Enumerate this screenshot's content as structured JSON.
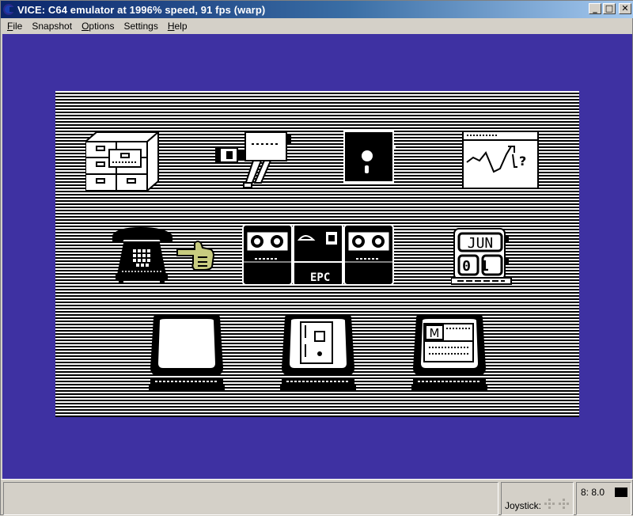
{
  "window": {
    "title": "VICE: C64 emulator at 1996% speed, 91 fps (warp)",
    "controls": {
      "minimize": "_",
      "maximize": "□",
      "close": "✕"
    }
  },
  "menu": {
    "items": [
      {
        "label": "File",
        "mnemonic": "F",
        "rest": "ile"
      },
      {
        "label": "Snapshot",
        "mnemonic": "",
        "rest": "Snapshot"
      },
      {
        "label": "Options",
        "mnemonic": "O",
        "rest": "ptions"
      },
      {
        "label": "Settings",
        "mnemonic": "",
        "rest": "Settings"
      },
      {
        "label": "Help",
        "mnemonic": "H",
        "rest": "elp"
      }
    ]
  },
  "emulator_screen": {
    "border_color": "#3e31a2",
    "background_pattern": "horizontal stripes black/white",
    "icons": [
      {
        "name": "file-cabinet-icon",
        "row": 1
      },
      {
        "name": "video-camera-icon",
        "row": 1
      },
      {
        "name": "floppy-disk-icon",
        "row": 1
      },
      {
        "name": "stock-chart-icon",
        "row": 1,
        "label_hint": "?"
      },
      {
        "name": "telephone-icon",
        "row": 2
      },
      {
        "name": "pointing-hand-cursor",
        "row": 2
      },
      {
        "name": "epc-tape-computer-icon",
        "row": 2,
        "label": "EPC"
      },
      {
        "name": "calendar-icon",
        "row": 2,
        "month": "JUN",
        "day": "01"
      },
      {
        "name": "blank-computer-icon",
        "row": 3
      },
      {
        "name": "design-computer-icon",
        "row": 3
      },
      {
        "name": "menu-computer-icon",
        "row": 3,
        "label": "M"
      }
    ]
  },
  "statusbar": {
    "joystick_label": "Joystick:",
    "drive_label": "8: 8.0",
    "drive_led_color": "#000000"
  }
}
